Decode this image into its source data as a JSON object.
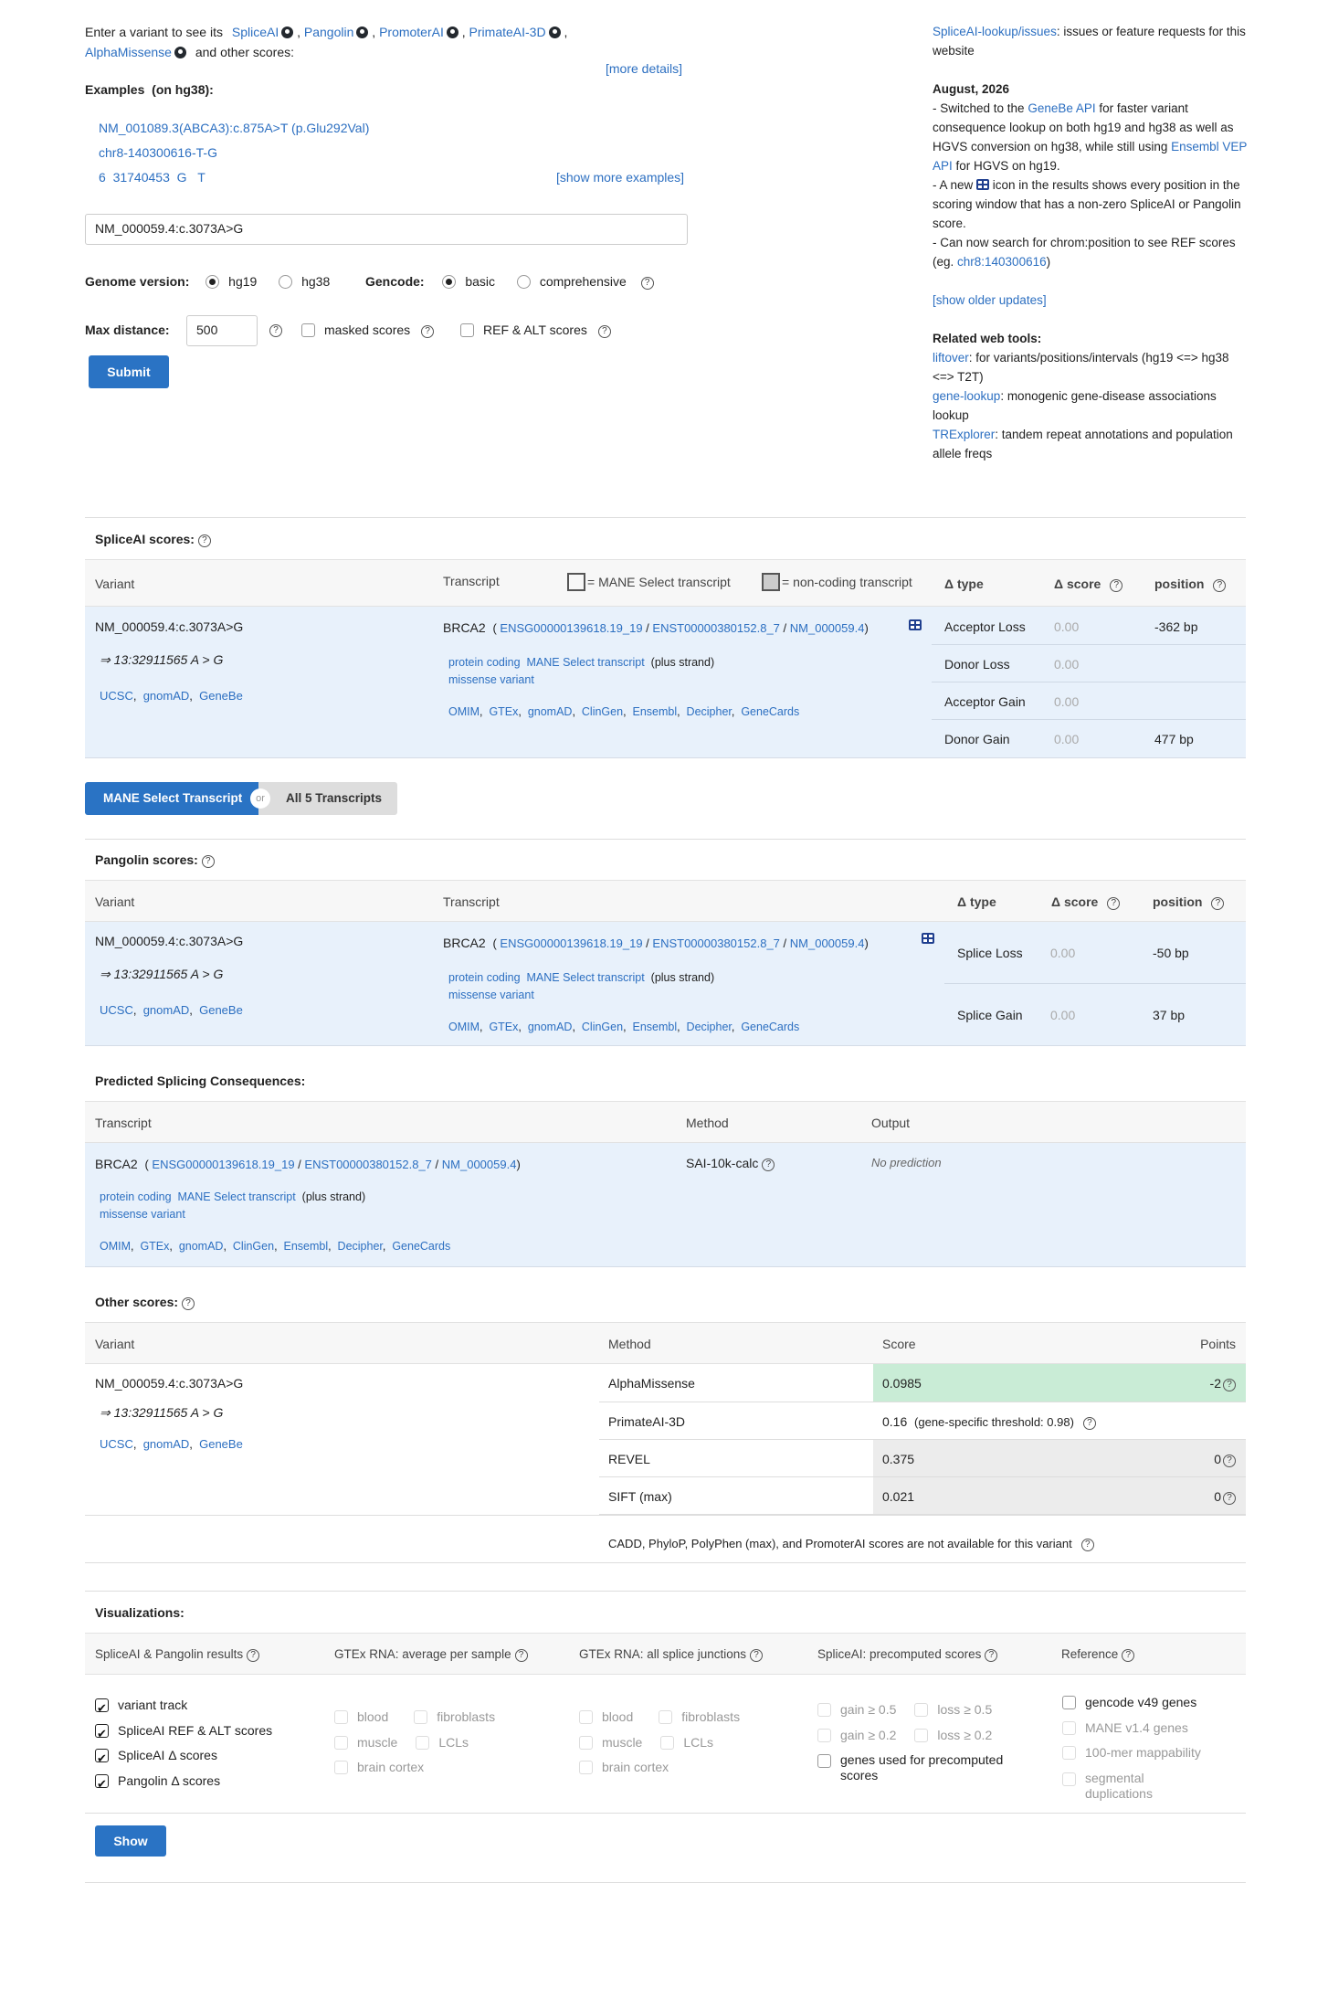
{
  "intro": {
    "prefix": "Enter a variant to see its",
    "tools": [
      "SpliceAI",
      "Pangolin",
      "PromoterAI",
      "PrimateAI-3D",
      "AlphaMissense"
    ],
    "suffix": "and other scores:",
    "more_details": "[more details]"
  },
  "examples": {
    "title": "Examples",
    "subtitle": "(on hg38):",
    "items": [
      "NM_001089.3(ABCA3):c.875A>T (p.Glu292Val)",
      "chr8-140300616-T-G"
    ],
    "item3_chrom": "6",
    "item3_pos": "31740453",
    "item3_ref": "G",
    "item3_alt": "T",
    "show_more": "[show more examples]"
  },
  "search": {
    "value": "NM_000059.4:c.3073A>G"
  },
  "options": {
    "genome_label": "Genome version:",
    "genome_opts": [
      "hg19",
      "hg38"
    ],
    "gencode_label": "Gencode:",
    "gencode_opts": [
      "basic",
      "comprehensive"
    ],
    "maxdist_label": "Max distance:",
    "maxdist_value": "500",
    "masked_label": "masked scores",
    "refalt_label": "REF & ALT scores",
    "submit": "Submit"
  },
  "sidebar": {
    "issues_link": "SpliceAI-lookup/issues",
    "issues_text": ": issues or feature requests for this website",
    "date": "August, 2026",
    "u1a": "- Switched to the ",
    "u1link": "GeneBe API",
    "u1b": " for faster variant consequence lookup on both hg19 and hg38 as well as HGVS conversion on hg38, while still using ",
    "u1link2": "Ensembl VEP API",
    "u1c": " for HGVS on hg19.",
    "u2a": "- A new ",
    "u2b": " icon in the results shows every position in the scoring window that has a non-zero SpliceAI or Pangolin score.",
    "u3a": "- Can now search for chrom:position to see REF scores (eg. ",
    "u3link": "chr8:140300616",
    "u3b": ")",
    "older": "[show older updates]",
    "tools_title": "Related web tools:",
    "t1link": "liftover",
    "t1text": ": for variants/positions/intervals (hg19 <=> hg38 <=> T2T)",
    "t2link": "gene-lookup",
    "t2text": ": monogenic gene-disease associations lookup",
    "t3link": "TRExplorer",
    "t3text": ": tandem repeat annotations and population allele freqs"
  },
  "variant": {
    "name": "NM_000059.4:c.3073A>G",
    "genomic": "⇒ 13:32911565 A > G",
    "links": [
      "UCSC",
      "gnomAD",
      "GeneBe"
    ]
  },
  "transcript": {
    "gene": "BRCA2",
    "ensg": "ENSG00000139618.19_19",
    "enst": "ENST00000380152.8_7",
    "nm": "NM_000059.4",
    "biotype": "protein coding",
    "mane": "MANE Select transcript",
    "strand": "(plus strand)",
    "consequence": "missense variant",
    "dblinks": [
      "OMIM",
      "GTEx",
      "gnomAD",
      "ClinGen",
      "Ensembl",
      "Decipher",
      "GeneCards"
    ]
  },
  "spliceai": {
    "title": "SpliceAI scores:",
    "col_variant": "Variant",
    "col_transcript": "Transcript",
    "legend_mane": "= MANE Select transcript",
    "legend_noncoding": "= non-coding transcript",
    "col_type": "Δ type",
    "col_score": "Δ score",
    "col_position": "position",
    "rows": [
      {
        "type": "Acceptor Loss",
        "score": "0.00",
        "position": "-362 bp"
      },
      {
        "type": "Donor Loss",
        "score": "0.00",
        "position": ""
      },
      {
        "type": "Acceptor Gain",
        "score": "0.00",
        "position": ""
      },
      {
        "type": "Donor Gain",
        "score": "0.00",
        "position": "477 bp"
      }
    ]
  },
  "toggle": {
    "mane": "MANE Select Transcript",
    "or": "or",
    "all": "All 5 Transcripts"
  },
  "pangolin": {
    "title": "Pangolin scores:",
    "col_variant": "Variant",
    "col_transcript": "Transcript",
    "col_type": "Δ type",
    "col_score": "Δ score",
    "col_position": "position",
    "rows": [
      {
        "type": "Splice Loss",
        "score": "0.00",
        "position": "-50 bp"
      },
      {
        "type": "Splice Gain",
        "score": "0.00",
        "position": "37 bp"
      }
    ]
  },
  "consequences": {
    "title": "Predicted Splicing Consequences:",
    "col_transcript": "Transcript",
    "col_method": "Method",
    "col_output": "Output",
    "method": "SAI-10k-calc",
    "output": "No prediction"
  },
  "other": {
    "title": "Other scores:",
    "col_variant": "Variant",
    "col_method": "Method",
    "col_score": "Score",
    "col_points": "Points",
    "rows": [
      {
        "method": "AlphaMissense",
        "score": "0.0985",
        "points": "-2"
      },
      {
        "method": "PrimateAI-3D",
        "score": "0.16",
        "note": "(gene-specific threshold: 0.98)",
        "points": ""
      },
      {
        "method": "REVEL",
        "score": "0.375",
        "points": "0"
      },
      {
        "method": "SIFT (max)",
        "score": "0.021",
        "points": "0"
      }
    ],
    "missing": "CADD,  PhyloP,  PolyPhen (max),  and PromoterAI scores are not available for this variant"
  },
  "viz": {
    "title": "Visualizations:",
    "cols": [
      "SpliceAI & Pangolin results",
      "GTEx RNA: average per sample",
      "GTEx RNA: all splice junctions",
      "SpliceAI: precomputed scores",
      "Reference"
    ],
    "results": [
      "variant track",
      "SpliceAI REF & ALT scores",
      "SpliceAI Δ  scores",
      "Pangolin Δ  scores"
    ],
    "gtex": [
      "blood",
      "fibroblasts",
      "muscle",
      "LCLs",
      "brain cortex"
    ],
    "precomputed": [
      "gain ≥ 0.5",
      "loss ≥ 0.5",
      "gain ≥ 0.2",
      "loss ≥ 0.2",
      "genes used for precomputed scores"
    ],
    "reference": [
      "gencode v49 genes",
      "MANE v1.4 genes",
      "100-mer mappability",
      "segmental duplications"
    ],
    "show": "Show"
  },
  "colors": {
    "link": "#2c6fc1",
    "row_bg": "#e8f1fb",
    "button": "#2a73c4",
    "alphamissense_bg": "#c9ecd6"
  }
}
